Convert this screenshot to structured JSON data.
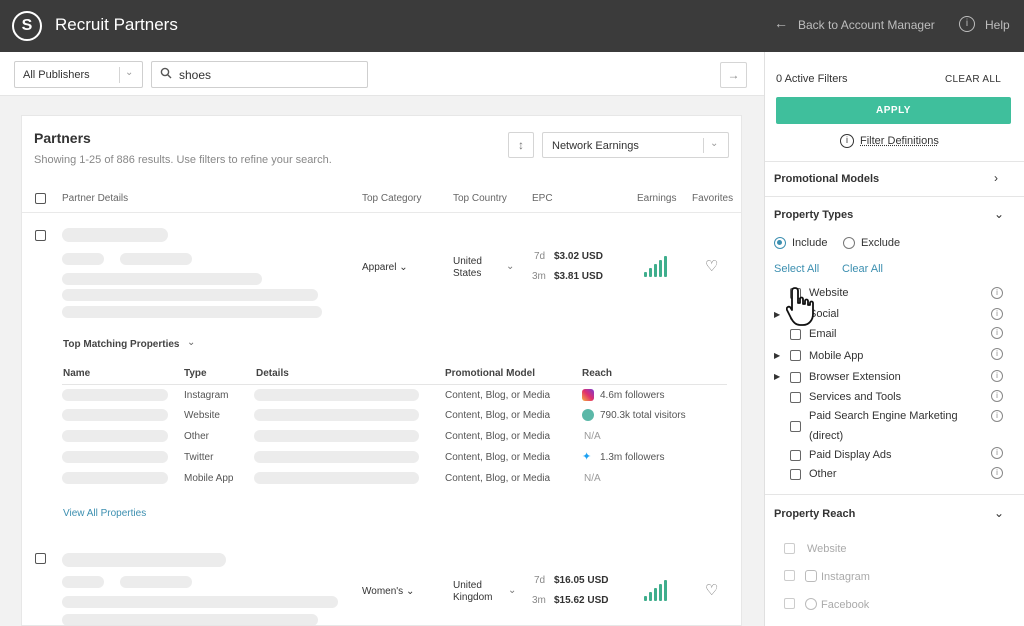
{
  "header": {
    "logo_glyph": "S",
    "title": "Recruit Partners",
    "back_label": "Back to Account Manager",
    "help_label": "Help"
  },
  "toolbar": {
    "publisher_filter": "All Publishers",
    "search_value": "shoes",
    "go_icon": "arrow-right-icon"
  },
  "partners": {
    "title": "Partners",
    "subtitle": "Showing 1-25 of 886 results. Use filters to refine your search.",
    "sort_value": "Network Earnings",
    "columns": [
      "Partner Details",
      "Top Category",
      "Top Country",
      "EPC",
      "Earnings",
      "Favorites"
    ],
    "rows": [
      {
        "category": "Apparel",
        "country": "United States",
        "epc_7d_label": "7d",
        "epc_7d": "$3.02 USD",
        "epc_3m_label": "3m",
        "epc_3m": "$3.81 USD"
      },
      {
        "category": "Women's",
        "country": "United Kingdom",
        "epc_7d_label": "7d",
        "epc_7d": "$16.05 USD",
        "epc_3m_label": "3m",
        "epc_3m": "$15.62 USD"
      }
    ],
    "top_matching": {
      "title": "Top Matching Properties",
      "columns": [
        "Name",
        "Type",
        "Details",
        "Promotional Model",
        "Reach"
      ],
      "rows": [
        {
          "type": "Instagram",
          "model": "Content, Blog, or Media",
          "reach": "4.6m followers",
          "reach_icon": "instagram-icon"
        },
        {
          "type": "Website",
          "model": "Content, Blog, or Media",
          "reach": "790.3k  total visitors",
          "reach_icon": "globe-icon"
        },
        {
          "type": "Other",
          "model": "Content, Blog, or Media",
          "reach": "N/A",
          "reach_icon": ""
        },
        {
          "type": "Twitter",
          "model": "Content, Blog, or Media",
          "reach": "1.3m followers",
          "reach_icon": "twitter-icon"
        },
        {
          "type": "Mobile App",
          "model": "Content, Blog, or Media",
          "reach": "N/A",
          "reach_icon": ""
        }
      ],
      "view_all": "View All Properties"
    }
  },
  "filters": {
    "active_count": "0 Active Filters",
    "clear_all": "CLEAR ALL",
    "apply": "APPLY",
    "definitions": "Filter Definitions",
    "promotional_models": "Promotional Models",
    "property_types": {
      "title": "Property Types",
      "include": "Include",
      "exclude": "Exclude",
      "selected_mode": "include",
      "select_all": "Select All",
      "clear_all": "Clear All",
      "items": [
        "Website",
        "Social",
        "Email",
        "Mobile App",
        "Browser Extension",
        "Services and Tools",
        "Paid Search Engine Marketing",
        "(direct)",
        "Paid Display Ads",
        "Other"
      ]
    },
    "property_reach": {
      "title": "Property Reach",
      "items": [
        "Website",
        "Instagram",
        "Facebook"
      ]
    }
  },
  "colors": {
    "topbar": "#3b3b3b",
    "accent_green": "#3fbf9c",
    "link_blue": "#3c8fb0"
  }
}
